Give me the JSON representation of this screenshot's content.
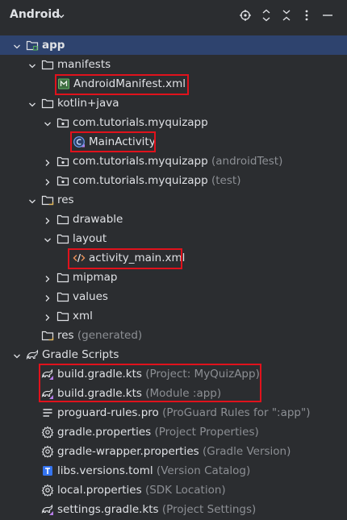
{
  "toolbar": {
    "title": "Android",
    "icons": [
      "chevron-down-icon",
      "target-icon",
      "expand-all-icon",
      "collapse-all-icon",
      "more-icon",
      "minimize-icon"
    ]
  },
  "tree": {
    "app": "app",
    "manifests": "manifests",
    "android_manifest": "AndroidManifest.xml",
    "kotlin_java": "kotlin+java",
    "pkg_main": "com.tutorials.myquizapp",
    "main_activity": "MainActivity",
    "pkg_android_test": "com.tutorials.myquizapp",
    "pkg_android_test_suffix": "(androidTest)",
    "pkg_test": "com.tutorials.myquizapp",
    "pkg_test_suffix": "(test)",
    "res": "res",
    "drawable": "drawable",
    "layout": "layout",
    "activity_main": "activity_main.xml",
    "mipmap": "mipmap",
    "values": "values",
    "xml": "xml",
    "res_generated": "res",
    "res_generated_suffix": "(generated)",
    "gradle_scripts": "Gradle Scripts",
    "build_project": "build.gradle.kts",
    "build_project_suffix": "(Project: MyQuizApp)",
    "build_module": "build.gradle.kts",
    "build_module_suffix": "(Module :app)",
    "proguard": "proguard-rules.pro",
    "proguard_suffix": "(ProGuard Rules for \":app\")",
    "gradle_properties": "gradle.properties",
    "gradle_properties_suffix": "(Project Properties)",
    "wrapper_properties": "gradle-wrapper.properties",
    "wrapper_properties_suffix": "(Gradle Version)",
    "libs_versions": "libs.versions.toml",
    "libs_versions_suffix": "(Version Catalog)",
    "local_properties": "local.properties",
    "local_properties_suffix": "(SDK Location)",
    "settings_gradle": "settings.gradle.kts",
    "settings_gradle_suffix": "(Project Settings)"
  },
  "colors": {
    "background": "#2b2d30",
    "selection": "#2e436e",
    "highlight_box": "#e0121c",
    "muted_text": "#8c8f94"
  }
}
